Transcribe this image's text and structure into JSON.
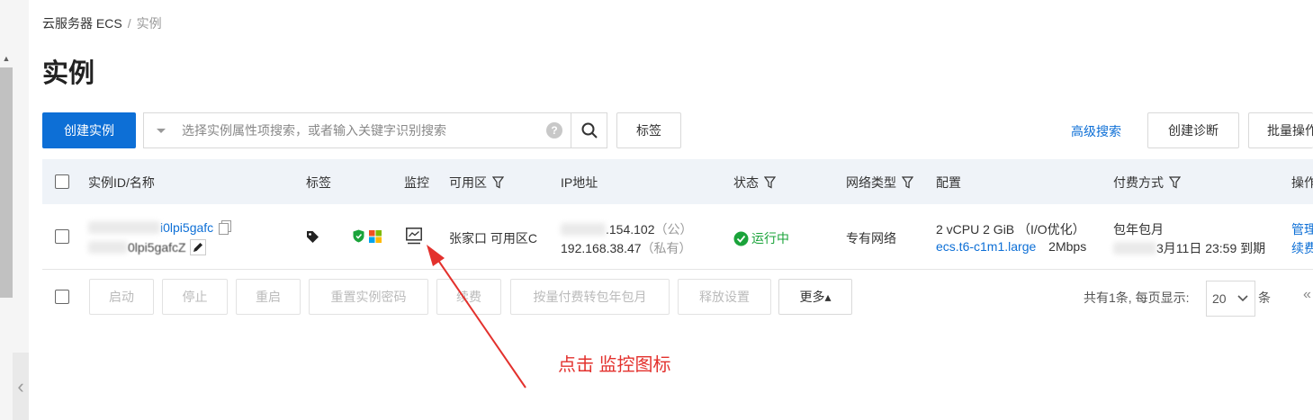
{
  "breadcrumb": {
    "root": "云服务器 ECS",
    "separator": "/",
    "current": "实例"
  },
  "page_title": "实例",
  "toolbar": {
    "create_label": "创建实例",
    "search_placeholder": "选择实例属性项搜索，或者输入关键字识别搜索",
    "help_glyph": "?",
    "tags_label": "标签",
    "advanced_search_label": "高级搜索",
    "create_diagnosis_label": "创建诊断",
    "batch_label": "批量操作"
  },
  "table": {
    "columns": {
      "id_name": "实例ID/名称",
      "tags": "标签",
      "monitor": "监控",
      "zone": "可用区",
      "ip": "IP地址",
      "status": "状态",
      "network": "网络类型",
      "config": "配置",
      "billing": "付费方式",
      "actions": "操作"
    },
    "rows": [
      {
        "instance_id_suffix": "i0lpi5gafc",
        "instance_name_suffix": "0lpi5gafcZ",
        "zone": "张家口 可用区C",
        "public_ip_suffix": ".154.102",
        "public_tag": "（公）",
        "private_ip": "192.168.38.47",
        "private_tag": "（私有）",
        "status": "运行中",
        "network_type": "专有网络",
        "config_line1": "2 vCPU 2 GiB （I/O优化）",
        "instance_type": "ecs.t6-c1m1.large",
        "bandwidth": "2Mbps",
        "billing_type": "包年包月",
        "expire_suffix": "3月11日 23:59 到期",
        "action_manage": "管理",
        "action_renew": "续费"
      }
    ]
  },
  "footer": {
    "buttons": [
      "启动",
      "停止",
      "重启",
      "重置实例密码",
      "续费",
      "按量付费转包年包月",
      "释放设置"
    ],
    "more_label": "更多▴",
    "total_text": "共有1条, 每页显示:",
    "page_size": "20",
    "unit": "条",
    "first_page_glyph": "«"
  },
  "annotation": {
    "text": "点击 监控图标"
  },
  "colors": {
    "primary": "#0d6fd6",
    "running": "#1aa33a",
    "annotation": "#e3312d"
  }
}
